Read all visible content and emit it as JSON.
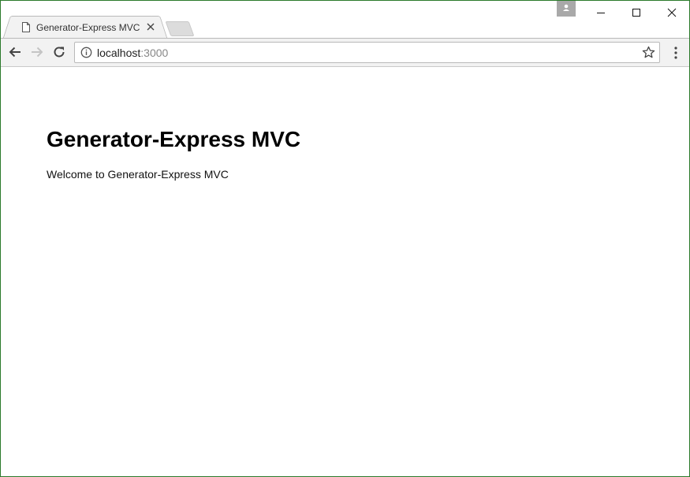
{
  "browser": {
    "tab": {
      "title": "Generator-Express MVC",
      "favicon_icon": "page-icon",
      "close_icon": "close-icon"
    },
    "new_tab_icon": "new-tab-icon",
    "profile_icon": "profile-icon",
    "window_controls": [
      "minimize-icon",
      "maximize-icon",
      "close-icon"
    ],
    "toolbar": {
      "back_icon": "back-arrow-icon",
      "forward_icon": "forward-arrow-icon",
      "reload_icon": "reload-icon",
      "info_icon": "info-icon",
      "url_host": "localhost",
      "url_port": ":3000",
      "bookmark_icon": "star-icon",
      "menu_icon": "kebab-menu-icon"
    }
  },
  "page": {
    "heading": "Generator-Express MVC",
    "text": "Welcome to Generator-Express MVC"
  },
  "colors": {
    "window_border": "#2b7a2b",
    "toolbar_bg": "#f2f2f2",
    "url_port": "#888888"
  }
}
